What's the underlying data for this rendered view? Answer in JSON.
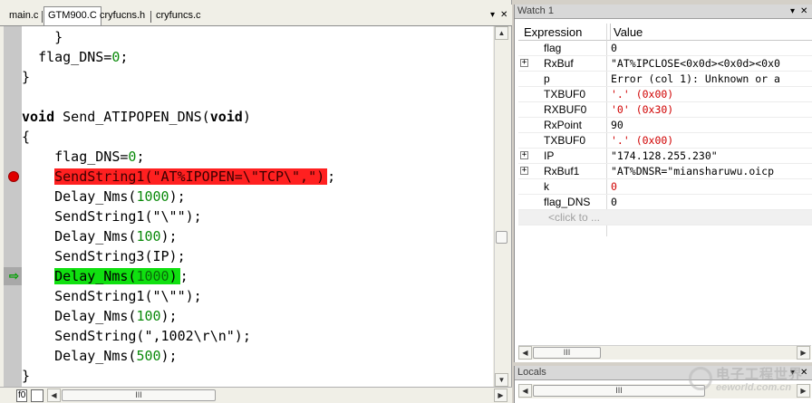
{
  "editor": {
    "tabs": [
      {
        "label": "main.c",
        "active": false
      },
      {
        "label": "GTM900.C",
        "active": true
      },
      {
        "label": "cryfucns.h",
        "active": false
      },
      {
        "label": "cryfuncs.c",
        "active": false
      }
    ],
    "tab_controls": {
      "dropdown": "▾",
      "close": "✕"
    },
    "code_lines": [
      {
        "indent": "    ",
        "text": "}"
      },
      {
        "indent": "  ",
        "text": "flag_DNS=",
        "num": "0",
        "tail": ";"
      },
      {
        "indent": "",
        "text": "}"
      },
      {
        "indent": "",
        "text": ""
      },
      {
        "indent": "",
        "kw1": "void",
        "text": " Send_ATIPOPEN_DNS(",
        "kw2": "void",
        "tail": ")"
      },
      {
        "indent": "",
        "text": "{"
      },
      {
        "indent": "    ",
        "text": "flag_DNS=",
        "num": "0",
        "tail": ";"
      },
      {
        "indent": "    ",
        "hl": "red",
        "text": "SendString1(\"AT%IPOPEN=\\\"TCP\\\",\")",
        "tail": ";"
      },
      {
        "indent": "    ",
        "text": "Delay_Nms(",
        "num": "1000",
        "tail": ");"
      },
      {
        "indent": "    ",
        "text": "SendString1(\"\\\"\");"
      },
      {
        "indent": "    ",
        "text": "Delay_Nms(",
        "num": "100",
        "tail": ");"
      },
      {
        "indent": "    ",
        "text": "SendString3(IP);"
      },
      {
        "indent": "    ",
        "hl": "green",
        "text": "Delay_Nms(",
        "num": "1000",
        "tail2": ")",
        "tail": ";"
      },
      {
        "indent": "    ",
        "text": "SendString1(\"\\\"\");"
      },
      {
        "indent": "    ",
        "text": "Delay_Nms(",
        "num": "100",
        "tail": ");"
      },
      {
        "indent": "    ",
        "text": "SendString(\",1002\\r\\n\");"
      },
      {
        "indent": "    ",
        "text": "Delay_Nms(",
        "num": "500",
        "tail": ");"
      },
      {
        "indent": "",
        "text": "}"
      }
    ],
    "breakpoint_line": 7,
    "current_line": 12,
    "status_mode": "f0",
    "scroll_grip": "III"
  },
  "watch": {
    "title": "Watch 1",
    "controls": {
      "pin": "▾",
      "close": "✕"
    },
    "columns": {
      "expression": "Expression",
      "value": "Value"
    },
    "rows": [
      {
        "name": "flag",
        "value": "0",
        "expandable": false,
        "changed": false
      },
      {
        "name": "RxBuf",
        "value": "\"AT%IPCLOSE<0x0d><0x0d><0x0",
        "expandable": true,
        "changed": false
      },
      {
        "name": "p",
        "value": "Error (col 1): Unknown or a",
        "expandable": false,
        "changed": false
      },
      {
        "name": "TXBUF0",
        "value": "'.' (0x00)",
        "expandable": false,
        "changed": true
      },
      {
        "name": "RXBUF0",
        "value": "'0' (0x30)",
        "expandable": false,
        "changed": true
      },
      {
        "name": "RxPoint",
        "value": "90",
        "expandable": false,
        "changed": false
      },
      {
        "name": "TXBUF0",
        "value": "'.' (0x00)",
        "expandable": false,
        "changed": true
      },
      {
        "name": "IP",
        "value": "\"174.128.255.230\"",
        "expandable": true,
        "changed": false
      },
      {
        "name": "RxBuf1",
        "value": "\"AT%DNSR=\"miansharuwu.oicp",
        "expandable": true,
        "changed": false
      },
      {
        "name": "k",
        "value": "0",
        "expandable": false,
        "changed": true
      },
      {
        "name": "flag_DNS",
        "value": "0",
        "expandable": false,
        "changed": false
      }
    ],
    "placeholder": "<click to ...",
    "expand_glyph": "+",
    "scroll_grip": "III"
  },
  "locals": {
    "title": "Locals",
    "controls": {
      "pin": "▾",
      "close": "✕"
    },
    "scroll_grip": "III"
  },
  "watermark": {
    "cn": "电子工程世界",
    "en": "eeworld.com.cn"
  }
}
